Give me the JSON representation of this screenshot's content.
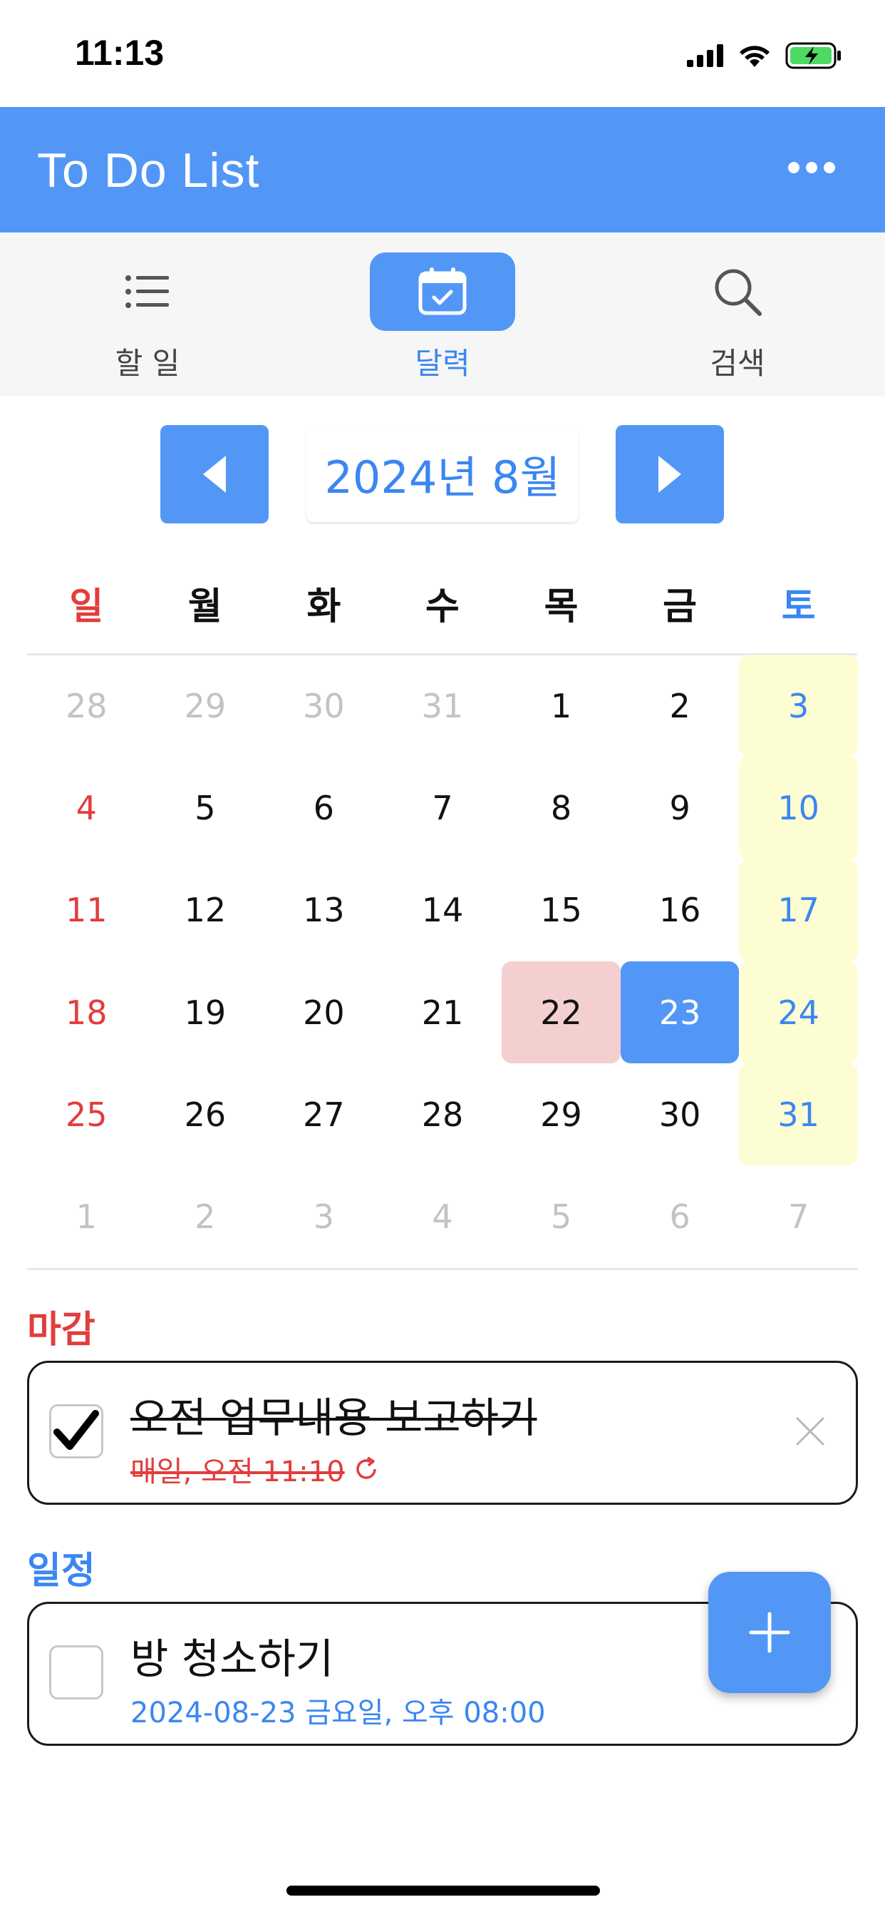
{
  "status": {
    "time": "11:13",
    "icons": [
      "signal-icon",
      "wifi-icon",
      "battery-charging-icon"
    ]
  },
  "header": {
    "title": "To Do List",
    "more_icon": "more-dots-icon"
  },
  "tabs": [
    {
      "label": "할 일",
      "icon": "list-icon",
      "active": false
    },
    {
      "label": "달력",
      "icon": "calendar-check-icon",
      "active": true
    },
    {
      "label": "검색",
      "icon": "search-icon",
      "active": false
    }
  ],
  "calendar": {
    "month_label": "2024년 8월",
    "weekdays": [
      "일",
      "월",
      "화",
      "수",
      "목",
      "금",
      "토"
    ],
    "weeks": [
      [
        "28",
        "29",
        "30",
        "31",
        "1",
        "2",
        "3"
      ],
      [
        "4",
        "5",
        "6",
        "7",
        "8",
        "9",
        "10"
      ],
      [
        "11",
        "12",
        "13",
        "14",
        "15",
        "16",
        "17"
      ],
      [
        "18",
        "19",
        "20",
        "21",
        "22",
        "23",
        "24"
      ],
      [
        "25",
        "26",
        "27",
        "28",
        "29",
        "30",
        "31"
      ],
      [
        "1",
        "2",
        "3",
        "4",
        "5",
        "6",
        "7"
      ]
    ],
    "today": "22",
    "selected": "23"
  },
  "sections": {
    "deadline": {
      "label": "마감",
      "item": {
        "title": "오전 업무내용 보고하기",
        "subtitle": "매일, 오전 11:10",
        "checked": true,
        "repeat_icon": "repeat-icon"
      }
    },
    "schedule": {
      "label": "일정",
      "item": {
        "title": "방 청소하기",
        "subtitle": "2024-08-23 금요일, 오후 08:00",
        "checked": false
      }
    }
  },
  "colors": {
    "accent": "#5297f6",
    "sunday": "#e23d3d",
    "saturday": "#3b86f2",
    "today_bg": "#f4cfcf",
    "saturday_bg": "#fdfdd3"
  }
}
